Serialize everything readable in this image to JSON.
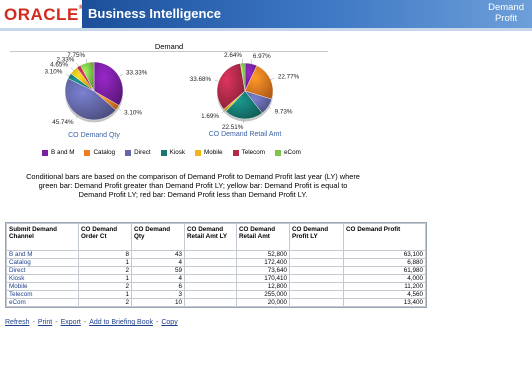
{
  "header": {
    "logo": "ORACLE",
    "app_title": "Business Intelligence",
    "right_title_line1": "Demand",
    "right_title_line2": "Profit"
  },
  "chart_section": {
    "title": "Demand"
  },
  "chart_data": [
    {
      "type": "pie",
      "caption": "CO Demand Qty",
      "slices": [
        {
          "name": "B and M",
          "value": 33.33,
          "label": "33.33%",
          "color": "#7b1fa2"
        },
        {
          "name": "Catalog",
          "value": 3.1,
          "label": "3.10%",
          "color": "#f07c20"
        },
        {
          "name": "Direct",
          "value": 45.74,
          "label": "45.74%",
          "color": "#6367a8"
        },
        {
          "name": "Kiosk",
          "value": 3.1,
          "label": "3.10%",
          "color": "#167a73"
        },
        {
          "name": "Mobile",
          "value": 4.65,
          "label": "4.65%",
          "color": "#f3b51b"
        },
        {
          "name": "Telecom",
          "value": 2.33,
          "label": "2.33%",
          "color": "#b22a4a"
        },
        {
          "name": "eCom",
          "value": 7.75,
          "label": "7.75%",
          "color": "#7ec44a"
        }
      ]
    },
    {
      "type": "pie",
      "caption": "CO Demand Retail Amt",
      "slices": [
        {
          "name": "B and M",
          "value": 6.97,
          "label": "6.97%",
          "color": "#7b1fa2"
        },
        {
          "name": "Catalog",
          "value": 22.77,
          "label": "22.77%",
          "color": "#f07c20"
        },
        {
          "name": "Direct",
          "value": 9.73,
          "label": "9.73%",
          "color": "#6367a8"
        },
        {
          "name": "Kiosk",
          "value": 22.51,
          "label": "22.51%",
          "color": "#167a73"
        },
        {
          "name": "Mobile",
          "value": 1.69,
          "label": "1.69%",
          "color": "#f3b51b"
        },
        {
          "name": "Telecom",
          "value": 33.68,
          "label": "33.68%",
          "color": "#b22a4a"
        },
        {
          "name": "eCom",
          "value": 2.64,
          "label": "2.64%",
          "color": "#7ec44a"
        }
      ]
    }
  ],
  "legend": [
    {
      "label": "B and M",
      "color": "#7b1fa2"
    },
    {
      "label": "Catalog",
      "color": "#f07c20"
    },
    {
      "label": "Direct",
      "color": "#6367a8"
    },
    {
      "label": "Kiosk",
      "color": "#167a73"
    },
    {
      "label": "Mobile",
      "color": "#f3b51b"
    },
    {
      "label": "Telecom",
      "color": "#b22a4a"
    },
    {
      "label": "eCom",
      "color": "#7ec44a"
    }
  ],
  "note": "Conditional bars are based on the comparison of Demand Profit to Demand Profit last year (LY) where green bar: Demand Profit greater than Demand Profit LY; yellow bar: Demand Profit is equal to Demand Profit LY; red bar: Demand Profit less than Demand Profit LY.",
  "table": {
    "headers": [
      "Submit Demand Channel",
      "CO Demand Order Ct",
      "CO Demand Qty",
      "CO Demand Retail Amt LY",
      "CO Demand Retail Amt",
      "CO Demand Profit LY",
      "CO Demand Profit"
    ],
    "rows": [
      {
        "channel": "B and M",
        "order_ct": "8",
        "qty": "43",
        "retail_ly": "",
        "retail": "52,800",
        "profit_ly": "",
        "profit": "63,100"
      },
      {
        "channel": "Catalog",
        "order_ct": "1",
        "qty": "4",
        "retail_ly": "",
        "retail": "172,400",
        "profit_ly": "",
        "profit": "6,880"
      },
      {
        "channel": "Direct",
        "order_ct": "2",
        "qty": "59",
        "retail_ly": "",
        "retail": "73,640",
        "profit_ly": "",
        "profit": "61,980"
      },
      {
        "channel": "Kiosk",
        "order_ct": "1",
        "qty": "4",
        "retail_ly": "",
        "retail": "170,410",
        "profit_ly": "",
        "profit": "4,000"
      },
      {
        "channel": "Mobile",
        "order_ct": "2",
        "qty": "6",
        "retail_ly": "",
        "retail": "12,800",
        "profit_ly": "",
        "profit": "11,200"
      },
      {
        "channel": "Telecom",
        "order_ct": "1",
        "qty": "3",
        "retail_ly": "",
        "retail": "255,000",
        "profit_ly": "",
        "profit": "4,560"
      },
      {
        "channel": "eCom",
        "order_ct": "2",
        "qty": "10",
        "retail_ly": "",
        "retail": "20,000",
        "profit_ly": "",
        "profit": "13,400"
      }
    ]
  },
  "links": [
    "Refresh",
    "Print",
    "Export",
    "Add to Briefing Book",
    "Copy"
  ]
}
